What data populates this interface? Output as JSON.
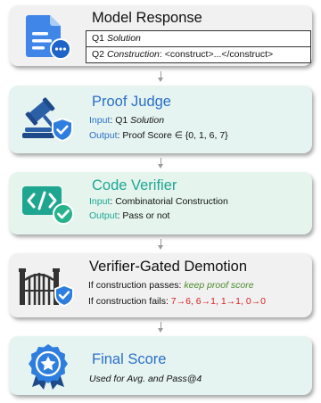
{
  "model_response": {
    "title": "Model Response",
    "q1_label": "Q1",
    "q1_value": "Solution",
    "q2_label": "Q2",
    "q2_value": "Construction",
    "q2_rest": ": <construct>...</construct>"
  },
  "proof_judge": {
    "title": "Proof Judge",
    "input_label": "Input",
    "input_prefix": ": Q1",
    "input_value": "Solution",
    "output_label": "Output",
    "output_value": ": Proof Score ∈ {0, 1, 6, 7}"
  },
  "code_verifier": {
    "title": "Code Verifier",
    "input_label": "Input",
    "input_value": ": Combinatorial Construction",
    "output_label": "Output",
    "output_value": ": Pass or not"
  },
  "demotion": {
    "title": "Verifier-Gated Demotion",
    "pass_text": "If construction passes: ",
    "pass_value": "keep proof score",
    "fail_text": "If construction fails: ",
    "fail_value": "7→6, 6→1, 1→1, 0→0"
  },
  "final": {
    "title": "Final Score",
    "subtitle": "Used for Avg. and Pass@4"
  },
  "colors": {
    "gray_panel": "#f1f1f1",
    "teal_panel": "#e6f4f1",
    "green_panel": "#e5f5ee",
    "blue_text": "#2a6fc9",
    "teal_text": "#1ea691",
    "red_text": "#e02020",
    "green_text": "#4a8a2a"
  }
}
